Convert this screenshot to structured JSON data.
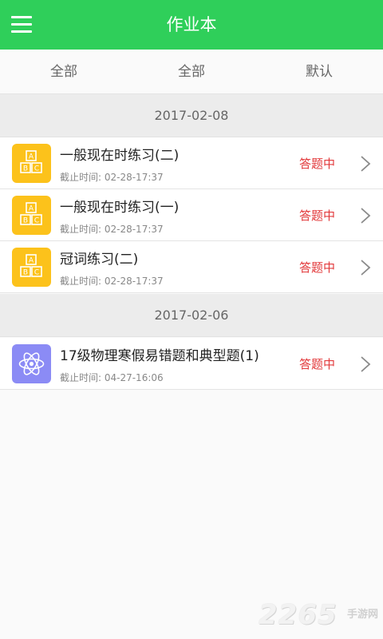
{
  "header": {
    "title": "作业本"
  },
  "filters": [
    "全部",
    "全部",
    "默认"
  ],
  "groups": [
    {
      "date": "2017-02-08",
      "items": [
        {
          "title": "一般现在时练习(二)",
          "deadline": "截止时间:  02-28-17:37",
          "status": "答题中",
          "icon": "abc-blocks-icon",
          "color": "#fcc21b"
        },
        {
          "title": "一般现在时练习(一)",
          "deadline": "截止时间:  02-28-17:37",
          "status": "答题中",
          "icon": "abc-blocks-icon",
          "color": "#fcc21b"
        },
        {
          "title": "冠词练习(二)",
          "deadline": "截止时间:  02-28-17:37",
          "status": "答题中",
          "icon": "abc-blocks-icon",
          "color": "#fcc21b"
        }
      ]
    },
    {
      "date": "2017-02-06",
      "items": [
        {
          "title": "17级物理寒假易错题和典型题(1)",
          "deadline": "截止时间:  04-27-16:06",
          "status": "答题中",
          "icon": "atom-icon",
          "color": "#8b8bf5"
        }
      ]
    }
  ],
  "watermark": {
    "number": "2265",
    "site": "手游网"
  }
}
